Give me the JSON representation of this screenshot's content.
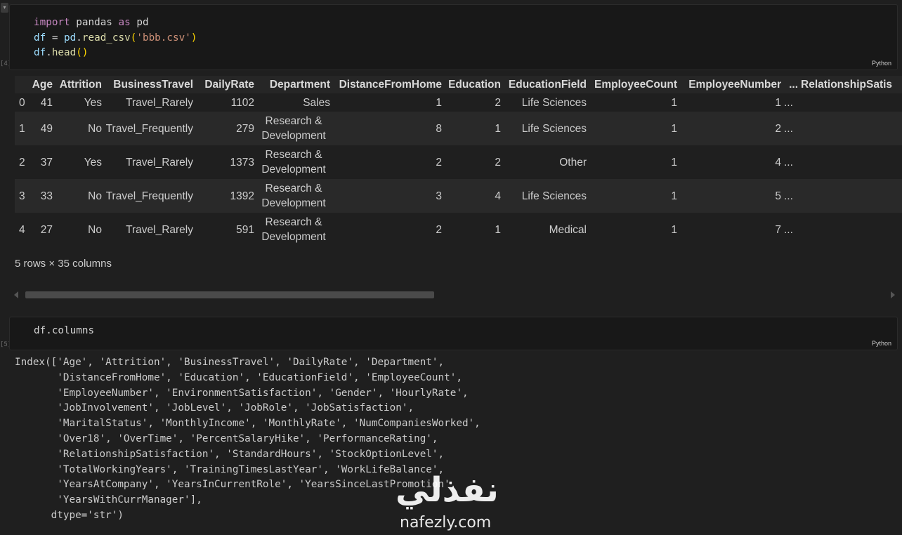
{
  "cell1": {
    "gutter_label": "[4]",
    "lang": "Python",
    "lines": [
      {
        "kw": "import",
        "mod": " pandas ",
        "as": "as",
        "alias": " pd"
      },
      {
        "var": "df",
        "eq": " = ",
        "obj": "pd",
        "dot": ".",
        "fn": "read_csv",
        "po": "(",
        "str": "'bbb.csv'",
        "pc": ")"
      },
      {
        "var": "df",
        "dot": ".",
        "fn": "head",
        "pp": "()"
      }
    ]
  },
  "dataframe": {
    "columns": [
      "",
      "Age",
      "Attrition",
      "BusinessTravel",
      "DailyRate",
      "Department",
      "DistanceFromHome",
      "Education",
      "EducationField",
      "EmployeeCount",
      "EmployeeNumber",
      "...",
      "RelationshipSatis"
    ],
    "rows": [
      [
        "0",
        "41",
        "Yes",
        "Travel_Rarely",
        "1102",
        "Sales",
        "1",
        "2",
        "Life Sciences",
        "1",
        "1",
        "..."
      ],
      [
        "1",
        "49",
        "No",
        "Travel_Frequently",
        "279",
        "Research & Development",
        "8",
        "1",
        "Life Sciences",
        "1",
        "2",
        "..."
      ],
      [
        "2",
        "37",
        "Yes",
        "Travel_Rarely",
        "1373",
        "Research & Development",
        "2",
        "2",
        "Other",
        "1",
        "4",
        "..."
      ],
      [
        "3",
        "33",
        "No",
        "Travel_Frequently",
        "1392",
        "Research & Development",
        "3",
        "4",
        "Life Sciences",
        "1",
        "5",
        "..."
      ],
      [
        "4",
        "27",
        "No",
        "Travel_Rarely",
        "591",
        "Research & Development",
        "2",
        "1",
        "Medical",
        "1",
        "7",
        "..."
      ]
    ],
    "summary": "5 rows × 35 columns"
  },
  "cell2": {
    "gutter_label": "[5]",
    "lang": "Python",
    "code": "df.columns"
  },
  "output": {
    "lines": [
      "Index(['Age', 'Attrition', 'BusinessTravel', 'DailyRate', 'Department',",
      "       'DistanceFromHome', 'Education', 'EducationField', 'EmployeeCount',",
      "       'EmployeeNumber', 'EnvironmentSatisfaction', 'Gender', 'HourlyRate',",
      "       'JobInvolvement', 'JobLevel', 'JobRole', 'JobSatisfaction',",
      "       'MaritalStatus', 'MonthlyIncome', 'MonthlyRate', 'NumCompaniesWorked',",
      "       'Over18', 'OverTime', 'PercentSalaryHike', 'PerformanceRating',",
      "       'RelationshipSatisfaction', 'StandardHours', 'StockOptionLevel',",
      "       'TotalWorkingYears', 'TrainingTimesLastYear', 'WorkLifeBalance',",
      "       'YearsAtCompany', 'YearsInCurrentRole', 'YearsSinceLastPromotion',",
      "       'YearsWithCurrManager'],",
      "      dtype='str')"
    ]
  },
  "watermark": {
    "logo": "نفذلي",
    "text": "nafezly.com"
  }
}
